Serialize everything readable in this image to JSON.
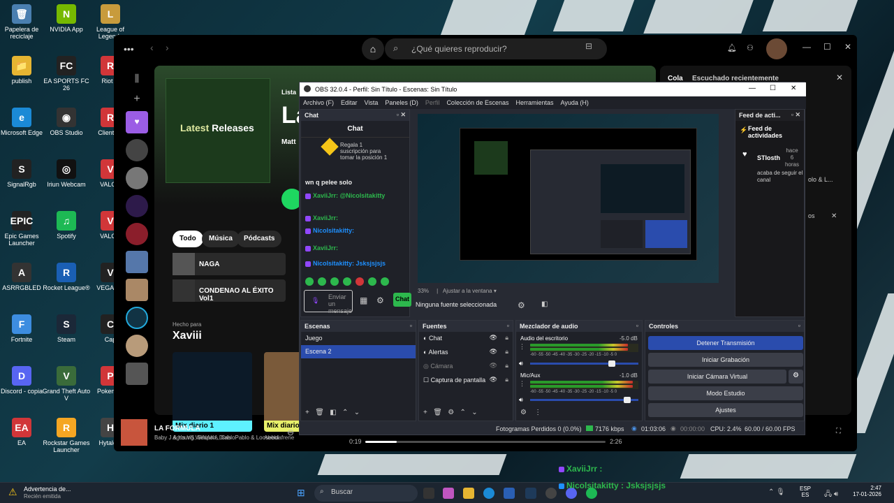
{
  "desktop": {
    "icons": [
      {
        "label": "Papelera de reciclaje",
        "glyph": "🗑",
        "color": "#4a7fb0"
      },
      {
        "label": "NVIDIA App",
        "glyph": "N",
        "color": "#76b900"
      },
      {
        "label": "League of Legends",
        "glyph": "L",
        "color": "#c89b3c"
      },
      {
        "label": "publish",
        "glyph": "📁",
        "color": "#e6b532"
      },
      {
        "label": "EA SPORTS FC 26",
        "glyph": "FC",
        "color": "#222"
      },
      {
        "label": "Riot C",
        "glyph": "R",
        "color": "#d13639"
      },
      {
        "label": "Microsoft Edge",
        "glyph": "e",
        "color": "#1b8ad6"
      },
      {
        "label": "OBS Studio",
        "glyph": "◉",
        "color": "#333"
      },
      {
        "label": "Cliente d",
        "glyph": "R",
        "color": "#d13639"
      },
      {
        "label": "SignalRgb",
        "glyph": "S",
        "color": "#222"
      },
      {
        "label": "Iriun Webcam",
        "glyph": "◎",
        "color": "#111"
      },
      {
        "label": "VALOR",
        "glyph": "V",
        "color": "#d13639"
      },
      {
        "label": "Epic Games Launcher",
        "glyph": "EPIC",
        "color": "#222"
      },
      {
        "label": "Spotify",
        "glyph": "♫",
        "color": "#1db954"
      },
      {
        "label": "VALOR",
        "glyph": "V",
        "color": "#d13639"
      },
      {
        "label": "ASRRGBLED",
        "glyph": "A",
        "color": "#333"
      },
      {
        "label": "Rocket League®",
        "glyph": "R",
        "color": "#1a5fb4"
      },
      {
        "label": "VEGAS P",
        "glyph": "V",
        "color": "#222"
      },
      {
        "label": "Fortnite",
        "glyph": "F",
        "color": "#3d8de0"
      },
      {
        "label": "Steam",
        "glyph": "S",
        "color": "#1b2838"
      },
      {
        "label": "Cap",
        "glyph": "C",
        "color": "#222"
      },
      {
        "label": "Discord - copia",
        "glyph": "D",
        "color": "#5865f2"
      },
      {
        "label": "Grand Theft Auto V",
        "glyph": "V",
        "color": "#3a6b3a"
      },
      {
        "label": "Pokemon",
        "glyph": "P",
        "color": "#d13639"
      },
      {
        "label": "EA",
        "glyph": "EA",
        "color": "#d13639"
      },
      {
        "label": "Rockstar Games Launcher",
        "glyph": "R",
        "color": "#f5a623"
      },
      {
        "label": "Hytale L",
        "glyph": "H",
        "color": "#444"
      }
    ]
  },
  "spotify": {
    "search_placeholder": "¿Qué quieres reproducir?",
    "playlist_label": "Lista",
    "playlist_title": "La",
    "playlist_sub": "Matt",
    "cover_text_a": "Latest ",
    "cover_text_b": "Releases",
    "filters": [
      "Todo",
      "Música",
      "Pódcasts"
    ],
    "rows": [
      {
        "title": "NAGA"
      },
      {
        "title": "CONDENAO AL ÉXITO Vol1"
      }
    ],
    "made_for": "Hecho para",
    "user": "Xaviii",
    "mix1": "Mix diario 1",
    "mix2": "Mix diario",
    "mix1_sub": "Agus VS, SINAKA, Cris",
    "mix2_sub": "Abeldafrene",
    "queue_tab": "Cola",
    "recent_tab": "Escuchado recientemente",
    "right_text1": "olo & L...",
    "right_text2": "os",
    "now_title": "LA FORMULA",
    "now_artist": "Baby J & Young Weapon, DiabloPablo & Looseboi",
    "elapsed": "0:19",
    "total": "2:26",
    "progress": 0.13
  },
  "obs": {
    "title": "OBS 32.0.4 - Perfil: Sin Título - Escenas: Sin Título",
    "menu": [
      "Archivo (F)",
      "Editar",
      "Vista",
      "Paneles (D)",
      "Perfil",
      "Colección de Escenas",
      "Herramientas",
      "Ayuda (H)"
    ],
    "chat_dock": "Chat",
    "chat_header": "Chat",
    "chat_gift": "Regala 1 suscripción para tomar la posición 1",
    "chat_lines": [
      {
        "text": "wn q pelee solo",
        "color": "#eee"
      },
      {
        "text": "XaviiJrr: @Nicolsitakitty",
        "color": "#2db84d"
      },
      {
        "text": "XaviiJrr:",
        "color": "#2db84d"
      },
      {
        "text": "Nicolsitakitty:",
        "color": "#1e90ff"
      },
      {
        "text": "XaviiJrr:",
        "color": "#2db84d"
      },
      {
        "text": "Nicolsitakitty: Jsksjsjsjs",
        "color": "#1e90ff"
      }
    ],
    "chat_input": "Enviar un mensaje",
    "chat_send": "Chat",
    "zoom": "33%",
    "fit": "Ajustar a la ventana",
    "no_source": "Ninguna fuente seleccionada",
    "feed_title": "Feed de acti...",
    "feed_sub": "Feed de actividades",
    "feed_user": "STIosth",
    "feed_time": "hace 6 horas",
    "feed_msg": "acaba de seguir el canal",
    "scenes_title": "Escenas",
    "scenes": [
      "Juego",
      "Escena 2"
    ],
    "sources_title": "Fuentes",
    "sources": [
      "Chat",
      "Alertas",
      "Cámara",
      "Captura de pantalla"
    ],
    "mixer_title": "Mezclador de audio",
    "mix_desktop": "Audio del escritorio",
    "mix_desktop_db": "-5.0 dB",
    "mix_desktop_level": 0.9,
    "mix_mic": "Mic/Aux",
    "mix_mic_db": "-1.0 dB",
    "mix_mic_level": 0.95,
    "meter_ticks": "-60 -55 -50 -45 -40 -35 -30 -25 -20 -15 -10 -5 0",
    "controls_title": "Controles",
    "btn_stop": "Detener Transmisión",
    "btn_record": "Iniciar Grabación",
    "btn_vcam": "Iniciar Cámara Virtual",
    "btn_studio": "Modo Estudio",
    "btn_settings": "Ajustes",
    "status_frames": "Fotogramas Perdidos 0 (0.0%)",
    "status_kbps": "7176 kbps",
    "status_live": "01:03:06",
    "status_rec": "00:00:00",
    "status_cpu": "CPU: 2.4%",
    "status_fps": "60.00 / 60.00 FPS"
  },
  "overlay": {
    "line1": "XaviiJrr :",
    "line2": "Nicolsitakitty : Jsksjsjsjs"
  },
  "taskbar": {
    "warn_title": "Advertencia de...",
    "warn_sub": "Recién emitida",
    "search": "Buscar",
    "lang1": "ESP",
    "lang2": "ES",
    "time": "2:47",
    "date": "17-01-2026"
  }
}
